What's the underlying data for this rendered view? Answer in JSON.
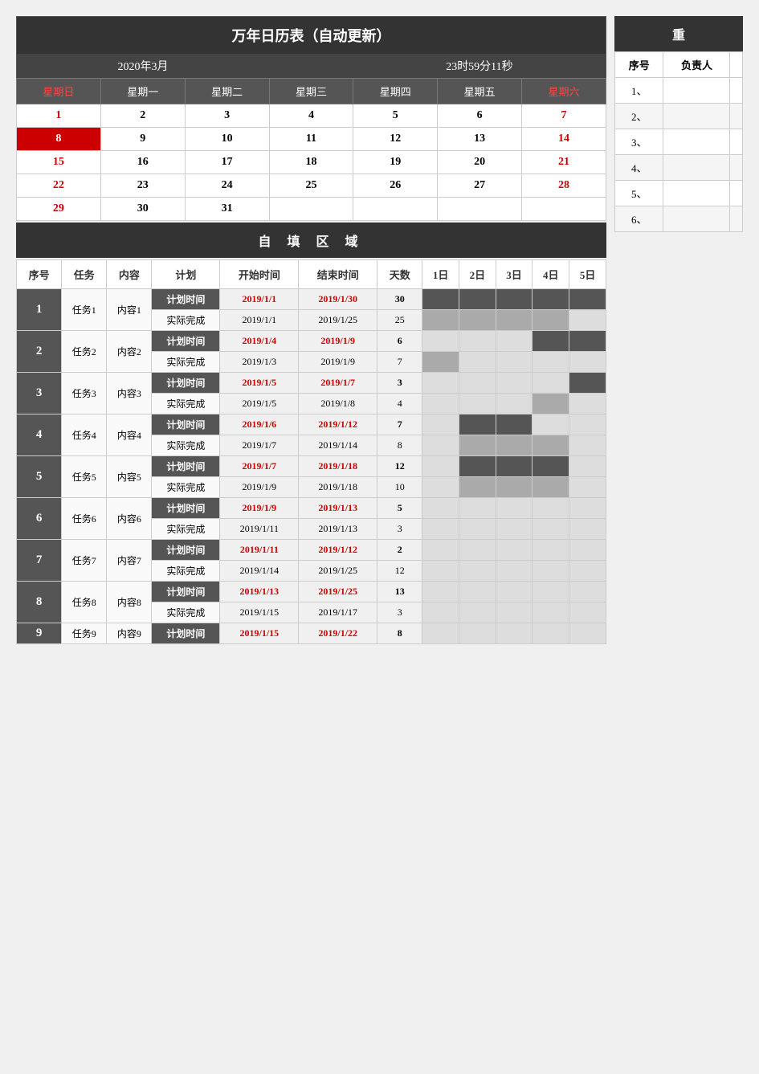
{
  "calendar": {
    "title": "万年日历表（自动更新）",
    "month_display": "2020年3月",
    "time_display": "23时59分11秒",
    "weekdays": [
      "星期日",
      "星期一",
      "星期二",
      "星期三",
      "星期四",
      "星期五",
      "星期六"
    ],
    "weeks": [
      [
        "1",
        "2",
        "3",
        "4",
        "5",
        "6",
        "7"
      ],
      [
        "red_bg",
        "9",
        "10",
        "11",
        "12",
        "13",
        "14"
      ],
      [
        "15",
        "16",
        "17",
        "18",
        "19",
        "20",
        "21"
      ],
      [
        "22",
        "23",
        "24",
        "25",
        "26",
        "27",
        "28"
      ],
      [
        "29",
        "30",
        "31",
        "",
        "",
        "",
        ""
      ]
    ]
  },
  "self_fill": {
    "title": "自  填  区  域",
    "headers": [
      "序号",
      "任务",
      "内容",
      "计划",
      "开始时间",
      "结束时间",
      "天数",
      "1日",
      "2日",
      "3日",
      "4日",
      "5日"
    ]
  },
  "tasks": [
    {
      "num": "1",
      "task": "任务1",
      "content": "内容1",
      "plan_start": "2019/1/1",
      "plan_end": "2019/1/30",
      "plan_days": "30",
      "actual_start": "2019/1/1",
      "actual_end": "2019/1/25",
      "actual_days": "25"
    },
    {
      "num": "2",
      "task": "任务2",
      "content": "内容2",
      "plan_start": "2019/1/4",
      "plan_end": "2019/1/9",
      "plan_days": "6",
      "actual_start": "2019/1/3",
      "actual_end": "2019/1/9",
      "actual_days": "7"
    },
    {
      "num": "3",
      "task": "任务3",
      "content": "内容3",
      "plan_start": "2019/1/5",
      "plan_end": "2019/1/7",
      "plan_days": "3",
      "actual_start": "2019/1/5",
      "actual_end": "2019/1/8",
      "actual_days": "4"
    },
    {
      "num": "4",
      "task": "任务4",
      "content": "内容4",
      "plan_start": "2019/1/6",
      "plan_end": "2019/1/12",
      "plan_days": "7",
      "actual_start": "2019/1/7",
      "actual_end": "2019/1/14",
      "actual_days": "8"
    },
    {
      "num": "5",
      "task": "任务5",
      "content": "内容5",
      "plan_start": "2019/1/7",
      "plan_end": "2019/1/18",
      "plan_days": "12",
      "actual_start": "2019/1/9",
      "actual_end": "2019/1/18",
      "actual_days": "10"
    },
    {
      "num": "6",
      "task": "任务6",
      "content": "内容6",
      "plan_start": "2019/1/9",
      "plan_end": "2019/1/13",
      "plan_days": "5",
      "actual_start": "2019/1/11",
      "actual_end": "2019/1/13",
      "actual_days": "3"
    },
    {
      "num": "7",
      "task": "任务7",
      "content": "内容7",
      "plan_start": "2019/1/11",
      "plan_end": "2019/1/12",
      "plan_days": "2",
      "actual_start": "2019/1/14",
      "actual_end": "2019/1/25",
      "actual_days": "12"
    },
    {
      "num": "8",
      "task": "任务8",
      "content": "内容8",
      "plan_start": "2019/1/13",
      "plan_end": "2019/1/25",
      "plan_days": "13",
      "actual_start": "2019/1/15",
      "actual_end": "2019/1/17",
      "actual_days": "3"
    },
    {
      "num": "9",
      "task": "任务9",
      "content": "内容9",
      "plan_start": "2019/1/15",
      "plan_end": "2019/1/22",
      "plan_days": "8",
      "actual_start": "",
      "actual_end": "",
      "actual_days": ""
    }
  ],
  "right_panel": {
    "title": "重",
    "headers": [
      "序号",
      "负责人"
    ],
    "rows": [
      "1、",
      "2、",
      "3、",
      "4、",
      "5、",
      "6、"
    ]
  },
  "labels": {
    "plan": "计划时间",
    "actual": "实际完成"
  }
}
